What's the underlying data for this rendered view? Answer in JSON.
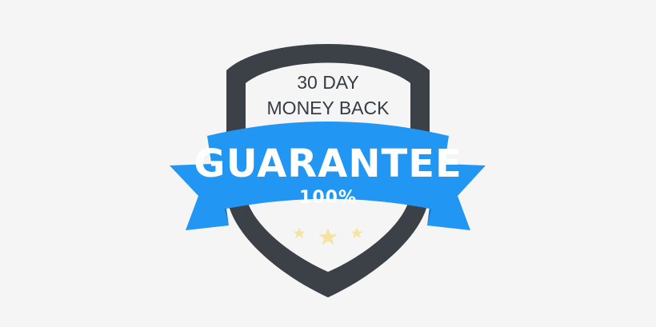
{
  "badge": {
    "line1": "30 DAY",
    "line2": "MONEY BACK",
    "headline": "GUARANTEE",
    "percent": "100%"
  },
  "icons": {
    "shield": "shield-icon",
    "ribbon": "ribbon-banner",
    "stars": [
      "star-icon",
      "star-icon",
      "star-icon"
    ]
  },
  "colors": {
    "background": "#f5f5f5",
    "shield_outline": "#3c4148",
    "shield_fill": "#f5f5f5",
    "ribbon_main": "#2196f3",
    "ribbon_dark": "#1576c7",
    "text_dark": "#363c44",
    "text_light": "#ffffff",
    "star": "#f6e3a1"
  }
}
